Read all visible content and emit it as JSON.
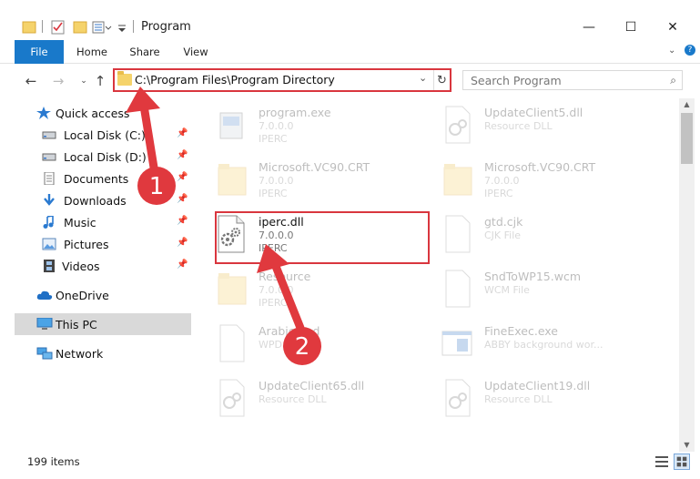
{
  "window": {
    "title": "Program",
    "minimize": "—",
    "maximize": "☐",
    "close": "✕"
  },
  "ribbon": {
    "tabs": [
      "File",
      "Home",
      "Share",
      "View"
    ]
  },
  "address": {
    "path": "C:\\Program Files\\Program Directory",
    "search_placeholder": "Search Program"
  },
  "sidebar": {
    "items": [
      {
        "label": "Quick access",
        "pinned": false
      },
      {
        "label": "Local Disk (C:)",
        "pinned": true
      },
      {
        "label": "Local Disk (D:)",
        "pinned": true
      },
      {
        "label": "Documents",
        "pinned": true
      },
      {
        "label": "Downloads",
        "pinned": true
      },
      {
        "label": "Music",
        "pinned": true
      },
      {
        "label": "Pictures",
        "pinned": true
      },
      {
        "label": "Videos",
        "pinned": true
      },
      {
        "label": "OneDrive",
        "pinned": false
      },
      {
        "label": "This PC",
        "pinned": false
      },
      {
        "label": "Network",
        "pinned": false
      }
    ]
  },
  "files": [
    {
      "name": "program.exe",
      "line2": "7.0.0.0",
      "line3": "IPERC",
      "icon": "exe-icon"
    },
    {
      "name": "UpdateClient5.dll",
      "line2": "Resource DLL",
      "line3": "",
      "icon": "dll-icon"
    },
    {
      "name": "Microsoft.VC90.CRT",
      "line2": "7.0.0.0",
      "line3": "IPERC",
      "icon": "folder-icon"
    },
    {
      "name": "Microsoft.VC90.CRT",
      "line2": "7.0.0.0",
      "line3": "IPERC",
      "icon": "folder-icon"
    },
    {
      "name": "iperc.dll",
      "line2": "7.0.0.0",
      "line3": "IPERC",
      "icon": "gear-dll-icon"
    },
    {
      "name": "gtd.cjk",
      "line2": "CJK File",
      "line3": "",
      "icon": "file-icon"
    },
    {
      "name": "Resource",
      "line2": "7.0.0.0",
      "line3": "IPERC",
      "icon": "folder-icon"
    },
    {
      "name": "SndToWP15.wcm",
      "line2": "WCM File",
      "line3": "",
      "icon": "file-icon"
    },
    {
      "name": "Arabic.ppd",
      "line2": "WPD File",
      "line3": "",
      "icon": "file-icon"
    },
    {
      "name": "FineExec.exe",
      "line2": "ABBY background wor...",
      "line3": "",
      "icon": "exe-window-icon"
    },
    {
      "name": "UpdateClient65.dll",
      "line2": "Resource DLL",
      "line3": "",
      "icon": "dll-icon"
    },
    {
      "name": "UpdateClient19.dll",
      "line2": "Resource DLL",
      "line3": "",
      "icon": "dll-icon"
    }
  ],
  "status": {
    "item_count": "199 items"
  },
  "annotations": {
    "step1": "1",
    "step2": "2",
    "color": "#e0393e"
  }
}
